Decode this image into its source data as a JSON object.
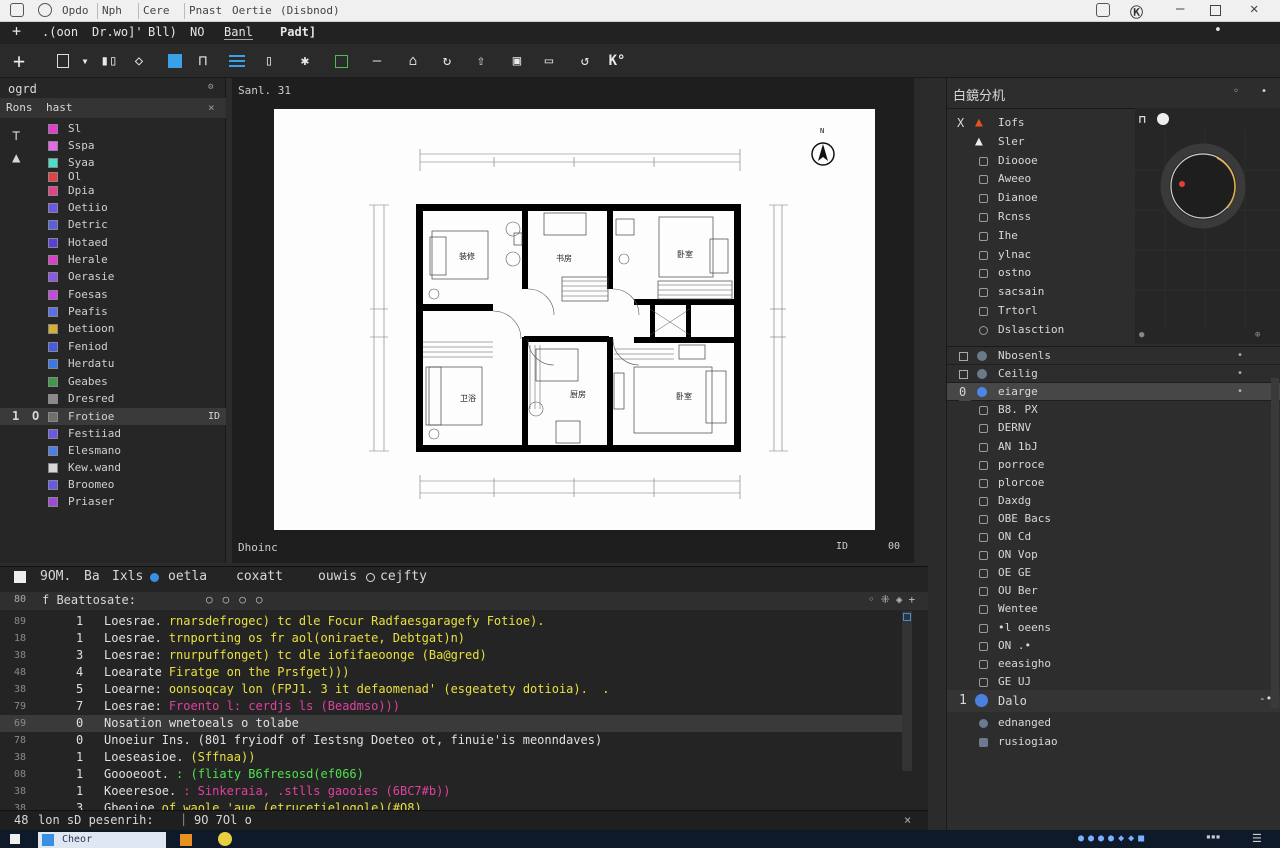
{
  "titlebar": {
    "tabs": [
      "Opdo",
      "Nph",
      "Cere",
      "Pnast",
      "Oertie",
      "(Disbnod)"
    ]
  },
  "menubar": {
    "items": [
      ".(oon",
      "Dr.wo]'",
      "Bll)",
      "NO",
      "Banl",
      "Padt]"
    ]
  },
  "toolbar": {
    "k_label": "K°",
    "accent": "#3aa0e8"
  },
  "left_panel": {
    "title": "ogrd",
    "subtitle": "Rons",
    "subtitle2": "hast",
    "rows": [
      {
        "label": "Sl",
        "color": "#e83ad0"
      },
      {
        "label": "Sspa",
        "color": "#e86ae8"
      },
      {
        "label": "Syaa",
        "color": "#4ae0c8"
      },
      {
        "label": "Ol",
        "color": "#e84040"
      },
      {
        "label": "Dpia",
        "color": "#e8408a"
      },
      {
        "label": "Oetiio",
        "color": "#6a58e8"
      },
      {
        "label": "Detric",
        "color": "#5860e0"
      },
      {
        "label": "Hotaed",
        "color": "#5a40d8"
      },
      {
        "label": "Herale",
        "color": "#d840c8"
      },
      {
        "label": "Oerasie",
        "color": "#8a58e8"
      },
      {
        "label": "Foesas",
        "color": "#c848e0"
      },
      {
        "label": "Peafis",
        "color": "#5870e8"
      },
      {
        "label": "betioon",
        "color": "#d8b030"
      },
      {
        "label": "Feniod",
        "color": "#4858e8"
      },
      {
        "label": "Herdatu",
        "color": "#3878e8"
      },
      {
        "label": "Geabes",
        "color": "#3e9848"
      },
      {
        "label": "Dresred",
        "color": "#8a8a8a"
      },
      {
        "label": "Frotioe",
        "color": "#707070"
      },
      {
        "label": "Festiiad",
        "color": "#6a58e8"
      },
      {
        "label": "Elesmano",
        "color": "#4880e8"
      },
      {
        "label": "Kew.wand",
        "color": "#d8d8d8"
      },
      {
        "label": "Broomeo",
        "color": "#6858e8"
      },
      {
        "label": "Priaser",
        "color": "#a048d8"
      }
    ],
    "selected_index": "1",
    "selected_key": "O",
    "selected_end": "ID"
  },
  "canvas": {
    "label": "Sanl. 31",
    "bottom_label": "Dhoinc",
    "bottom_right": "ID",
    "bottom_right2": "00",
    "north": "N",
    "rooms": [
      "装修",
      "书房",
      "卧室",
      "卫浴",
      "厨房",
      "卧室"
    ]
  },
  "bottom_panel": {
    "header": "9OM.",
    "header_b": "Ba",
    "header_c": "Ixls",
    "header_d": "oetla",
    "header_e": "coxatt",
    "header_f": "ouwis",
    "header_g": "cejfty",
    "search_label": "f Beattosate:",
    "lines": [
      {
        "ln": "89",
        "num": "1",
        "text": "Loesrae.",
        "rest": " rnarsdefrogec) tc dle Focur Radfaesgaragefy Fotioe).",
        "color": "#e8e040"
      },
      {
        "ln": "18",
        "num": "1",
        "text": "Loesrae.",
        "rest": " trnporting os fr aol(oniraete, Debtgat)n)",
        "color": "#e8e040"
      },
      {
        "ln": "38",
        "num": "3",
        "text": "Loesrae:",
        "rest": " rnurpuffonget) tc dle iofifaeoonge (Ba@gred)",
        "color": "#e8e040"
      },
      {
        "ln": "48",
        "num": "4",
        "text": "Loearate",
        "rest": " Firatge on the Prsfget)))",
        "color": "#e8e040"
      },
      {
        "ln": "38",
        "num": "5",
        "text": "Loearne:",
        "rest": " oonsoqcay lon (FPJ1. 3 it defaomenad' (esgeatety dotioia).  .",
        "color": "#e8e040"
      },
      {
        "ln": "79",
        "num": "7",
        "text": "Loesrae:",
        "rest": " Froento l: cerdjs ls (Beadmso)))",
        "color": "#e040a0"
      },
      {
        "ln": "69",
        "num": "0",
        "text": "Nosation",
        "rest": " wnetoeals o tolabe",
        "color": "#e0e0e0"
      },
      {
        "ln": "78",
        "num": "0",
        "text": "Unoeiur Ins.",
        "rest": " (801 fryiodf of Iestsng Doeteo ot, finuie'is meonndaves)",
        "color": "#e0e0e0"
      },
      {
        "ln": "38",
        "num": "1",
        "text": "Loeseasioe.",
        "rest": " (Sffnaa))",
        "color": "#e8e040"
      },
      {
        "ln": "08",
        "num": "1",
        "text": "Goooeoot.",
        "rest": " : (fliaty B6fresosd(ef066)",
        "color": "#50e050"
      },
      {
        "ln": "38",
        "num": "1",
        "text": "Koeeresoe.",
        "rest": " : Sinkeraia, .stlls gaooies (6BC7#b))",
        "color": "#e040a0"
      },
      {
        "ln": "38",
        "num": "3",
        "text": "Gbeoioe",
        "rest": " of waole 'aue (etrucetielogole)(#Q8)",
        "color": "#e8e040"
      }
    ],
    "status": "lon sD pesenrih:",
    "status_pos": "9O 7Ol o",
    "status_left": "48"
  },
  "right_panel": {
    "title": "白鏡分机",
    "tree": [
      {
        "label": "Iofs",
        "mark": "X"
      },
      {
        "label": "Sler",
        "mark": ""
      },
      {
        "label": "Dioooe"
      },
      {
        "label": "Aweeo"
      },
      {
        "label": "Dianoe"
      },
      {
        "label": "Rcnss"
      },
      {
        "label": "Ihe"
      },
      {
        "label": "ylnac"
      },
      {
        "label": "ostno"
      },
      {
        "label": "sacsain"
      },
      {
        "label": "Trtorl"
      },
      {
        "label": "Dslasction"
      }
    ],
    "sections": [
      {
        "label": "Nbosenls"
      },
      {
        "label": "Ceilig"
      },
      {
        "label": "eiarge",
        "selected": true
      },
      {
        "label": "B8. PX"
      },
      {
        "label": "DERNV"
      },
      {
        "label": "AN 1bJ"
      },
      {
        "label": "porroce"
      },
      {
        "label": "plorcoe"
      },
      {
        "label": "Daxdg"
      },
      {
        "label": "OBE Bacs"
      },
      {
        "label": "ON Cd"
      },
      {
        "label": "ON Vop"
      },
      {
        "label": "OE GE"
      },
      {
        "label": "OU Ber"
      },
      {
        "label": "Wentee"
      },
      {
        "label": "•l oeens"
      },
      {
        "label": "ON .•"
      },
      {
        "label": "eeasigho"
      },
      {
        "label": "GE UJ"
      }
    ],
    "lower": {
      "index": "1",
      "title": "Dalo",
      "items": [
        "ednanged",
        "rusiogiao"
      ]
    },
    "selected_index": "0",
    "dial_accent": "#e04030"
  },
  "taskbar": {
    "app_label": "Cheor"
  }
}
